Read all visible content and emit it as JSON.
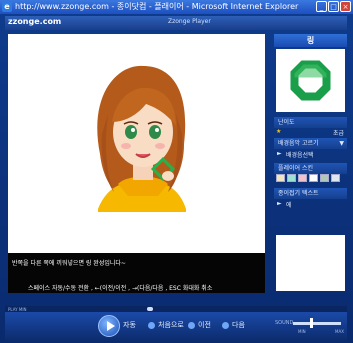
{
  "window": {
    "title": "http://www.zzonge.com - 종이닷컴 - 플래이어 - Microsoft Internet Explorer",
    "buttons": [
      "_",
      "□",
      "×"
    ]
  },
  "header": {
    "brand": "zzonge.com",
    "player_title": "Zzonge Player"
  },
  "side": {
    "title": "링",
    "difficulty_label": "난이도",
    "difficulty_value": "초급",
    "bg_select_label": "배경음악 고르기",
    "bg_select_value": "배경음선택",
    "skin_label": "플레이어 스킨",
    "skin_colors": [
      "#f1e6bf",
      "#9fe0d4",
      "#f3c0cc",
      "#ffffff",
      "#b0c8b8",
      "#dfe6f0"
    ],
    "photo_label": "종이접기 텍스트",
    "photo_sub": "에"
  },
  "caption": {
    "line1": "반쪽을 다른 쪽에 끼워넣으면 링 완성입니다~",
    "line2": "스페이스 자동/수동 전환 , ←(이전/이전 , →(다음/다음 , ESC 화대화 취소"
  },
  "controls": {
    "play_mode": "PLAY MIN",
    "auto_label": "자동",
    "first_label": "처음으로",
    "prev_label": "이전",
    "next_label": "다음",
    "sound_label": "SOUND",
    "vol_min": "MIN",
    "vol_max": "MAX"
  }
}
